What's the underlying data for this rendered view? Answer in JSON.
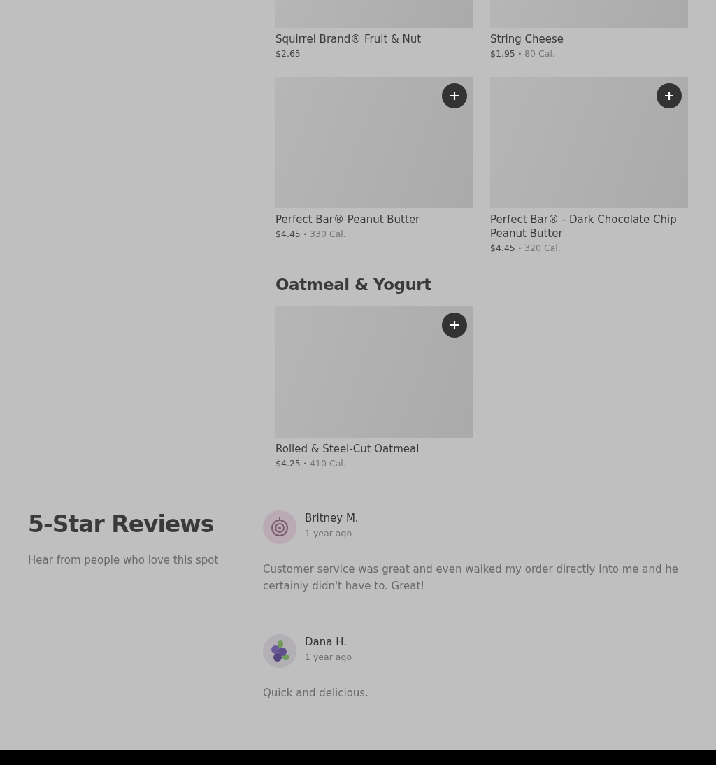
{
  "menu_sections": [
    {
      "items": [
        {
          "name": "Squirrel Brand® Fruit & Nut",
          "price": "$2.65",
          "cropped": true
        },
        {
          "name": "String Cheese",
          "price": "$1.95",
          "separator": "•",
          "calories": "80 Cal.",
          "cropped": true
        },
        {
          "name": "Perfect Bar® Peanut Butter",
          "price": "$4.45",
          "separator": "•",
          "calories": "330 Cal.",
          "add_button": true,
          "cropped": false
        },
        {
          "name": "Perfect Bar® - Dark Chocolate Chip Peanut Butter",
          "price": "$4.45",
          "separator": "•",
          "calories": "320 Cal.",
          "add_button": true,
          "cropped": false
        }
      ]
    },
    {
      "title": "Oatmeal & Yogurt",
      "items": [
        {
          "name": "Rolled & Steel-Cut Oatmeal",
          "price": "$4.25",
          "separator": "•",
          "calories": "410 Cal.",
          "add_button": true,
          "cropped": false
        }
      ]
    }
  ],
  "reviews": {
    "title": "5-Star Reviews",
    "subtitle": "Hear from people who love this spot",
    "items": [
      {
        "avatar": {
          "kind": "onion"
        },
        "name": "Britney M.",
        "time": "1 year ago",
        "text": "Customer service was great and even walked my order directly into me and he certainly didn't have to. Great!"
      },
      {
        "avatar": {
          "kind": "berries"
        },
        "name": "Dana H.",
        "time": "1 year ago",
        "text": "Quick and delicious."
      }
    ]
  }
}
